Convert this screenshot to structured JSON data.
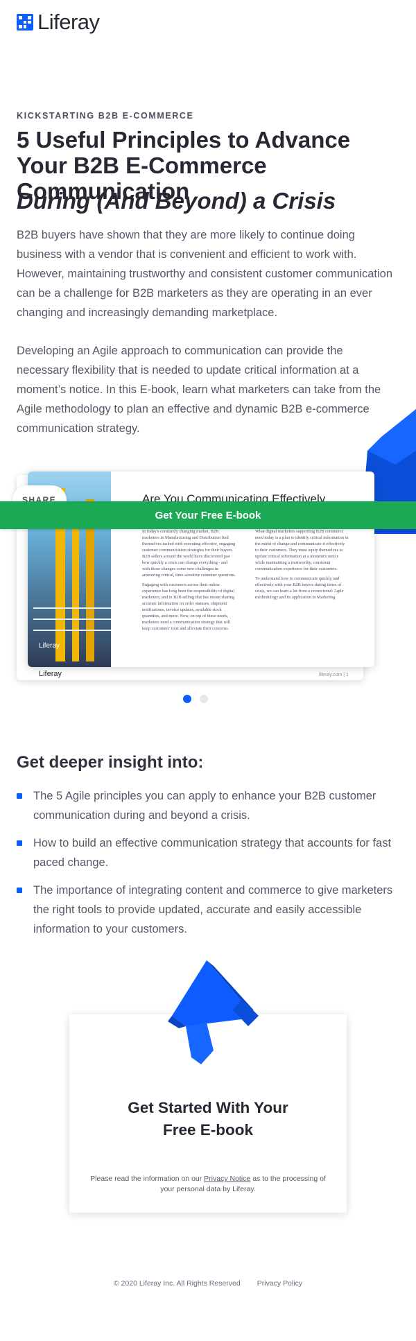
{
  "brand": {
    "logo_text": "Liferay",
    "accent": "#0b5fff",
    "cta_green": "#1ba956"
  },
  "hero": {
    "eyebrow": "KICKSTARTING B2B E-COMMERCE",
    "title": "5 Useful Principles to Advance Your B2B E-Commerce Communication",
    "subtitle": "During (And Beyond) a Crisis",
    "paragraph_1": "B2B buyers have shown that they are more likely to continue doing business with a vendor that is convenient and efficient to work with. However, maintaining trustworthy and consistent customer communication can be a challenge for B2B marketers as they are operating in an ever changing and increasingly demanding marketplace.",
    "paragraph_2": "Developing an Agile approach to communication can provide the necessary flexibility that is needed to update critical information at a moment’s notice. In this E-book, learn what marketers can take from the Agile methodology to plan an effective and dynamic B2B e-commerce communication strategy."
  },
  "preview": {
    "share_label": "SHARE",
    "cta_label": "Get Your Free E-book",
    "card_title": "Are You Communicating Effectively",
    "col1_p1": "In today's constantly changing market, B2B marketers in Manufacturing and Distribution find themselves tasked with executing effective, engaging customer communication strategies for their buyers. B2B sellers around the world have discovered just how quickly a crisis can change everything - and with those changes come new challenges in answering critical, time-sensitive customer questions.",
    "col1_p2": "Engaging with customers across their online experience has long been the responsibility of digital marketers, and in B2B selling that has meant sharing accurate information on order statuses, shipment notifications, invoice updates, available stock quantities, and more. Now, on top of these needs, marketers need a communication strategy that will keep customers' trust and alleviate their concerns.",
    "col2_p1": "What digital marketers supporting B2B commerce need today is a plan to identify critical information in the midst of change and communicate it effectively to their customers. They must equip themselves to update critical information at a moment's notice while maintaining a trustworthy, consistent communication experience for their customers.",
    "col2_p2": "To understand how to communicate quickly and effectively with your B2B buyers during times of crisis, we can learn a lot from a recent trend: Agile methodology and its application in Marketing.",
    "image_brand": "Liferay",
    "footer_logo": "Liferay",
    "footer_page": "liferay.com | 1"
  },
  "insight": {
    "title": "Get deeper insight into:",
    "items": [
      "The 5 Agile principles you can apply to enhance your B2B customer communication during and beyond a crisis.",
      "How to build an effective communication strategy that accounts for fast paced change.",
      "The importance of integrating content and commerce to give marketers the right tools to provide updated, accurate and easily accessible information to your customers."
    ]
  },
  "get_started": {
    "title_line1": "Get Started With Your",
    "title_line2": "Free E-book",
    "notice_pre": "Please read the information on our ",
    "notice_link": "Privacy Notice",
    "notice_post": " as to the processing of your personal data by Liferay."
  },
  "footer": {
    "copyright": "© 2020 Liferay Inc. All Rights Reserved",
    "privacy": "Privacy Policy"
  },
  "carousel": {
    "active_index": 0,
    "count": 2
  }
}
